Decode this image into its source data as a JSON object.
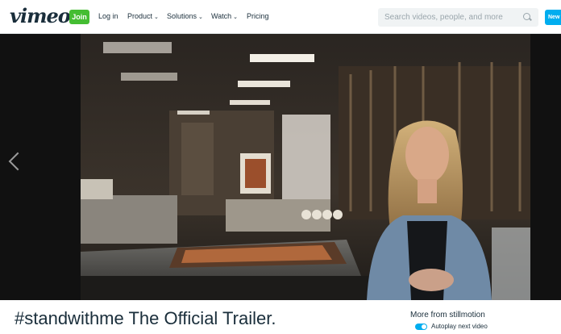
{
  "header": {
    "logo": "vimeo",
    "join_label": "Join",
    "nav": {
      "login": "Log in",
      "product": "Product",
      "solutions": "Solutions",
      "watch": "Watch",
      "pricing": "Pricing"
    },
    "search_placeholder": "Search videos, people, and more",
    "new_label": "New"
  },
  "video": {
    "title": "#standwithme The Official Trailer."
  },
  "sidebar": {
    "more_from": "More from stillmotion",
    "autoplay_label": "Autoplay next video",
    "autoplay_on": true
  },
  "colors": {
    "brand": "#1a2e3b",
    "join_green": "#44bd32",
    "accent_blue": "#00adef"
  }
}
